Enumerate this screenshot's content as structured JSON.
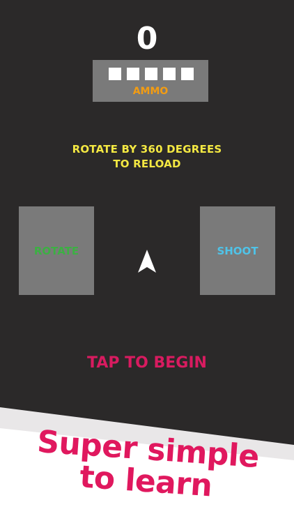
{
  "hud": {
    "score": "0",
    "ammo": {
      "count": 5,
      "label": "AMMO",
      "label_color": "#f39c12",
      "slot_color": "#ffffff"
    }
  },
  "instruction": {
    "line1": "ROTATE BY 360 DEGREES",
    "line2": "TO RELOAD",
    "color": "#f4e842"
  },
  "controls": {
    "rotate_label": "ROTATE",
    "rotate_color": "#3cb043",
    "shoot_label": "SHOOT",
    "shoot_color": "#4fc3e8",
    "ship_icon": "arrow-ship-icon"
  },
  "prompt": {
    "tap_label": "TAP TO BEGIN",
    "color": "#d81b60"
  },
  "banner": {
    "line1": "Super simple",
    "line2": "to learn",
    "color": "#e0185e"
  },
  "colors": {
    "background": "#2b2929",
    "panel": "#7a7a7a"
  }
}
